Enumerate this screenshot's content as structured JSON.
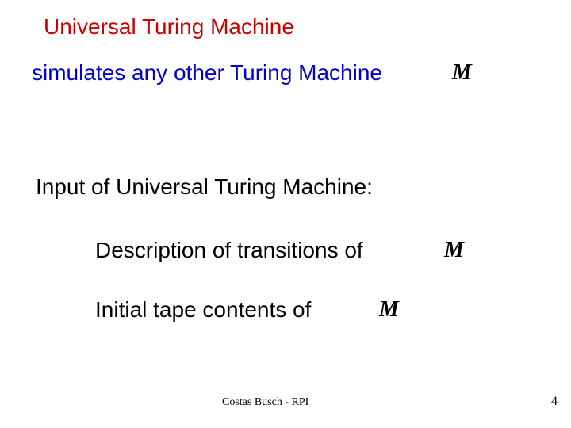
{
  "title": "Universal Turing Machine",
  "subtitle": "simulates any other Turing Machine",
  "machine_symbol": "M",
  "section_heading": "Input of  Universal Turing Machine:",
  "bullets": [
    "Description of transitions of",
    "Initial tape contents of"
  ],
  "footer": "Costas Busch - RPI",
  "page_number": "4"
}
